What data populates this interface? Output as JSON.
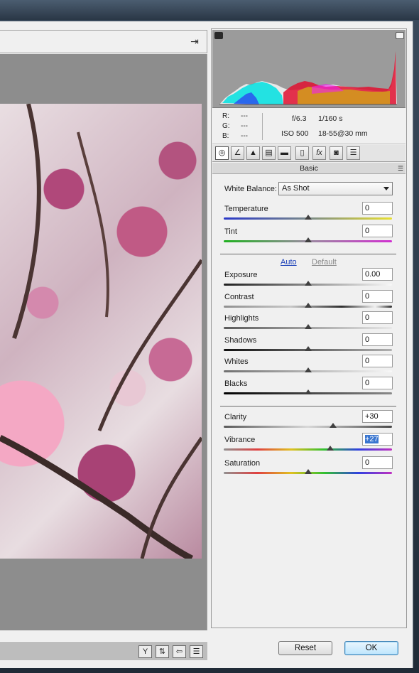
{
  "window": {
    "title": ""
  },
  "histogram": {
    "rgb_labels": [
      "R:",
      "G:",
      "B:"
    ],
    "rgb_values": [
      "---",
      "---",
      "---"
    ],
    "aperture": "f/6.3",
    "shutter": "1/160 s",
    "iso": "ISO 500",
    "lens": "18-55@30 mm"
  },
  "tabs": [
    "basic-icon",
    "tone-curve-icon",
    "detail-icon",
    "hsl-icon",
    "split-toning-icon",
    "lens-corrections-icon",
    "effects-icon",
    "camera-calibration-icon",
    "presets-icon"
  ],
  "panel": {
    "title": "Basic",
    "menu_glyph": "☰",
    "white_balance_label": "White Balance:",
    "white_balance_value": "As Shot",
    "auto_label": "Auto",
    "default_label": "Default",
    "sliders": {
      "temperature": {
        "label": "Temperature",
        "value": "0"
      },
      "tint": {
        "label": "Tint",
        "value": "0"
      },
      "exposure": {
        "label": "Exposure",
        "value": "0.00"
      },
      "contrast": {
        "label": "Contrast",
        "value": "0"
      },
      "highlights": {
        "label": "Highlights",
        "value": "0"
      },
      "shadows": {
        "label": "Shadows",
        "value": "0"
      },
      "whites": {
        "label": "Whites",
        "value": "0"
      },
      "blacks": {
        "label": "Blacks",
        "value": "0"
      },
      "clarity": {
        "label": "Clarity",
        "value": "+30"
      },
      "vibrance": {
        "label": "Vibrance",
        "value": "+27"
      },
      "saturation": {
        "label": "Saturation",
        "value": "0"
      }
    }
  },
  "buttons": {
    "reset": "Reset",
    "ok": "OK"
  },
  "statusbar_icons": [
    "Y",
    "⇅",
    "⇦",
    "☰"
  ],
  "colors": {
    "accent_link": "#1a3fb8",
    "selection": "#3a76d0"
  }
}
